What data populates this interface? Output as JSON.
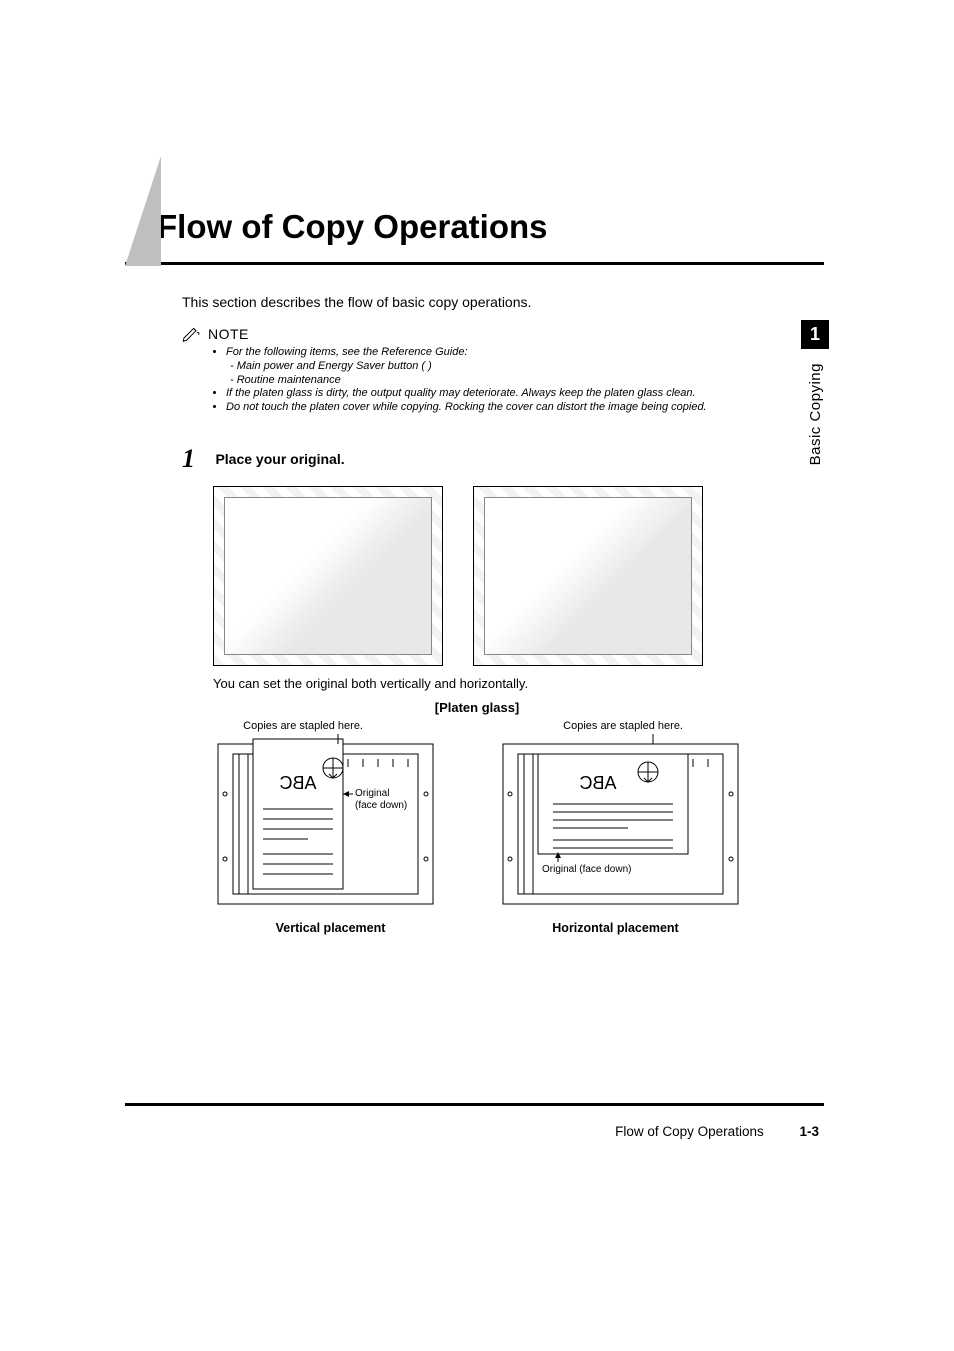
{
  "heading": "Flow of Copy Operations",
  "intro": "This section describes the flow of basic copy operations.",
  "note": {
    "label": "NOTE",
    "items": [
      "For the following items, see the Reference Guide:",
      "If the platen glass is dirty, the output quality may deteriorate. Always keep the platen glass clean.",
      "Do not touch the platen cover while copying. Rocking the cover can distort the image being copied."
    ],
    "sub_items": [
      "Main power and Energy Saver button (      )",
      "Routine maintenance"
    ]
  },
  "step": {
    "number": "1",
    "title": "Place your original.",
    "illus_note": "You can set the original both vertically and horizontally.",
    "platen_label": "[Platen glass]",
    "staple_label": "Copies are stapled here.",
    "vertical_label": "Vertical placement",
    "horizontal_label": "Horizontal placement",
    "original_label_v1": "Original",
    "original_label_v2": "(face down)",
    "original_label_h": "Original (face down)",
    "doc_text": "ABC"
  },
  "side_tab": {
    "number": "1",
    "label": "Basic Copying"
  },
  "footer": {
    "title": "Flow of Copy Operations",
    "page": "1-3"
  }
}
